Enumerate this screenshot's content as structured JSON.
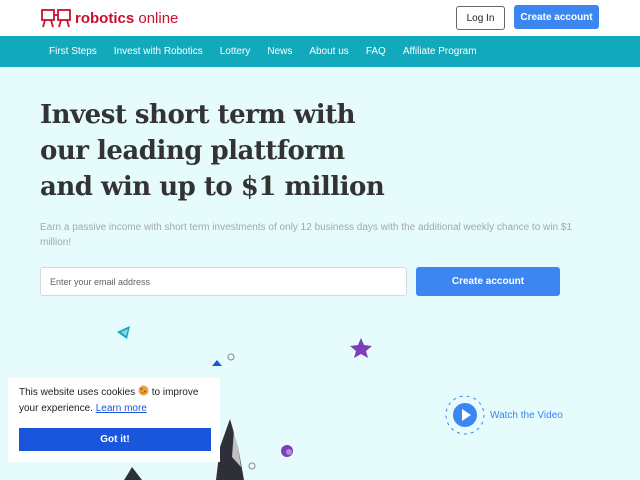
{
  "header": {
    "logo": {
      "bold": "robotics",
      "light": "online"
    },
    "login_label": "Log In",
    "create_account_label": "Create account"
  },
  "nav": {
    "items": [
      "First Steps",
      "Invest with Robotics",
      "Lottery",
      "News",
      "About us",
      "FAQ",
      "Affiliate Program"
    ]
  },
  "hero": {
    "headline_lines": [
      "Invest short term with",
      "our leading plattform",
      "and win up to $1 million"
    ],
    "subtext": "Earn a passive income with short term investments of only 12 business days with the additional weekly chance to win $1 million!",
    "email_placeholder": "Enter your email address",
    "create_account_label": "Create account",
    "watch_video_label": "Watch the Video"
  },
  "cookie": {
    "text_before": "This website uses cookies",
    "text_after": "to improve your experience.",
    "learn_more": "Learn more",
    "accept_label": "Got it!"
  },
  "colors": {
    "brand_red": "#c8102e",
    "nav_teal": "#13a9bc",
    "accent_blue": "#3b86f0",
    "hero_bg": "#e6fbfc",
    "cookie_blue": "#1a56db"
  },
  "icons": [
    "robot-logo-icon",
    "triangle-shape-icon",
    "star-shape-icon",
    "play-icon",
    "cookie-icon"
  ]
}
